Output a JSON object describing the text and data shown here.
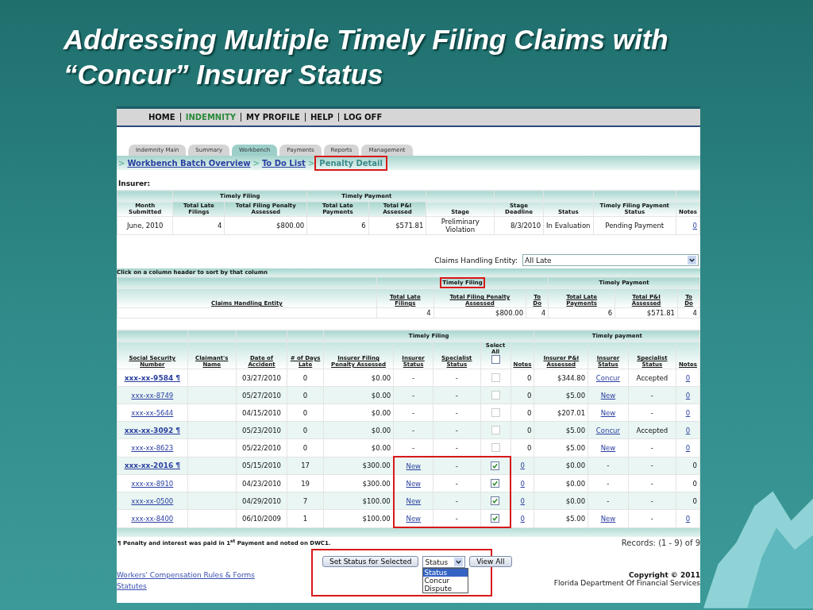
{
  "slide_title": "Addressing Multiple Timely Filing Claims with “Concur” Insurer Status",
  "nav": [
    {
      "label": "HOME",
      "selected": false
    },
    {
      "label": "INDEMNITY",
      "selected": true
    },
    {
      "label": "MY PROFILE",
      "selected": false
    },
    {
      "label": "HELP",
      "selected": false
    },
    {
      "label": "LOG OFF",
      "selected": false
    }
  ],
  "tabs": [
    {
      "label": "Indemnity Main",
      "selected": false
    },
    {
      "label": "Summary",
      "selected": false
    },
    {
      "label": "Workbench",
      "selected": true
    },
    {
      "label": "Payments",
      "selected": false
    },
    {
      "label": "Reports",
      "selected": false
    },
    {
      "label": "Management",
      "selected": false
    }
  ],
  "breadcrumb": {
    "separator": ">",
    "items": [
      {
        "label": "Workbench Batch Overview",
        "current": false,
        "highlighted": false
      },
      {
        "label": "To Do List",
        "current": false,
        "highlighted": false
      },
      {
        "label": "Penalty Detail",
        "current": true,
        "highlighted": true
      }
    ]
  },
  "insurer_label": "Insurer:",
  "summary": {
    "group_filing": "Timely Filing",
    "group_payment": "Timely Payment",
    "columns": [
      "Month Submitted",
      "Total Late Filings",
      "Total Filing Penalty Assessed",
      "Total Late Payments",
      "Total P&I Assessed",
      "Stage",
      "Stage Deadline",
      "Status",
      "Timely Filing Payment Status",
      "Notes"
    ],
    "row": [
      {
        "text": "June, 2010",
        "link": false
      },
      {
        "text": "4",
        "link": false
      },
      {
        "text": "$800.00",
        "link": false
      },
      {
        "text": "6",
        "link": false
      },
      {
        "text": "$571.81",
        "link": false
      },
      {
        "text": "Preliminary Violation",
        "link": false
      },
      {
        "text": "8/3/2010",
        "link": false
      },
      {
        "text": "In Evaluation",
        "link": false
      },
      {
        "text": "Pending Payment",
        "link": false
      },
      {
        "text": "0",
        "link": true
      }
    ]
  },
  "entity_filter": {
    "label": "Claims Handling Entity:",
    "value": "All Late"
  },
  "sort_hint": "Click on a column header to sort by that column",
  "entity_table": {
    "group_filing": "Timely Filing",
    "group_filing_highlighted": true,
    "group_payment": "Timely Payment",
    "columns": [
      "Claims Handling Entity",
      "Total Late Filings",
      "Total Filing Penalty Assessed",
      "To Do",
      "Total Late Payments",
      "Total P&I Assessed",
      "To Do"
    ],
    "row": [
      "4",
      "$800.00",
      "4",
      "6",
      "$571.81",
      "4"
    ]
  },
  "claims": {
    "group_filing": "Timely Filing",
    "group_payment": "Timely payment",
    "select_all": {
      "label": "Select All",
      "checked": false
    },
    "columns": [
      "Social Security Number",
      "Claimant's Name",
      "Date of Accident",
      "# of Days Late",
      "Insurer Filing Penalty Assessed",
      "Insurer Status",
      "Specialist Status",
      "Notes",
      "Insurer P&I Assessed",
      "Insurer Status",
      "Specialist Status",
      "Notes"
    ],
    "rows": [
      {
        "ssn": "xxx-xx-9584 ¶",
        "bold": true,
        "date": "03/27/2010",
        "days": "0",
        "penalty": "$0.00",
        "fil_status": "-",
        "fil_status_link": false,
        "fil_spec": "-",
        "checked": false,
        "disabled": true,
        "fil_notes": "0",
        "fil_notes_link": false,
        "pi": "$344.80",
        "pay_status": "Concur",
        "pay_status_link": true,
        "pay_spec": "Accepted",
        "pay_notes": "0",
        "pay_notes_link": true,
        "highlighted": false
      },
      {
        "ssn": "xxx-xx-8749",
        "bold": false,
        "date": "05/27/2010",
        "days": "0",
        "penalty": "$0.00",
        "fil_status": "-",
        "fil_status_link": false,
        "fil_spec": "-",
        "checked": false,
        "disabled": true,
        "fil_notes": "0",
        "fil_notes_link": false,
        "pi": "$5.00",
        "pay_status": "New",
        "pay_status_link": true,
        "pay_spec": "-",
        "pay_notes": "0",
        "pay_notes_link": true,
        "highlighted": false
      },
      {
        "ssn": "xxx-xx-5644",
        "bold": false,
        "date": "04/15/2010",
        "days": "0",
        "penalty": "$0.00",
        "fil_status": "-",
        "fil_status_link": false,
        "fil_spec": "-",
        "checked": false,
        "disabled": true,
        "fil_notes": "0",
        "fil_notes_link": false,
        "pi": "$207.01",
        "pay_status": "New",
        "pay_status_link": true,
        "pay_spec": "-",
        "pay_notes": "0",
        "pay_notes_link": true,
        "highlighted": false
      },
      {
        "ssn": "xxx-xx-3092 ¶",
        "bold": true,
        "date": "05/23/2010",
        "days": "0",
        "penalty": "$0.00",
        "fil_status": "-",
        "fil_status_link": false,
        "fil_spec": "-",
        "checked": false,
        "disabled": true,
        "fil_notes": "0",
        "fil_notes_link": false,
        "pi": "$5.00",
        "pay_status": "Concur",
        "pay_status_link": true,
        "pay_spec": "Accepted",
        "pay_notes": "0",
        "pay_notes_link": true,
        "highlighted": false
      },
      {
        "ssn": "xxx-xx-8623",
        "bold": false,
        "date": "05/22/2010",
        "days": "0",
        "penalty": "$0.00",
        "fil_status": "-",
        "fil_status_link": false,
        "fil_spec": "-",
        "checked": false,
        "disabled": true,
        "fil_notes": "0",
        "fil_notes_link": false,
        "pi": "$5.00",
        "pay_status": "New",
        "pay_status_link": true,
        "pay_spec": "-",
        "pay_notes": "0",
        "pay_notes_link": true,
        "highlighted": false
      },
      {
        "ssn": "xxx-xx-2016 ¶",
        "bold": true,
        "date": "05/15/2010",
        "days": "17",
        "penalty": "$300.00",
        "fil_status": "New",
        "fil_status_link": true,
        "fil_spec": "-",
        "checked": true,
        "disabled": false,
        "fil_notes": "0",
        "fil_notes_link": true,
        "pi": "$0.00",
        "pay_status": "-",
        "pay_status_link": false,
        "pay_spec": "-",
        "pay_notes": "0",
        "pay_notes_link": false,
        "highlighted": true
      },
      {
        "ssn": "xxx-xx-8910",
        "bold": false,
        "date": "04/23/2010",
        "days": "19",
        "penalty": "$300.00",
        "fil_status": "New",
        "fil_status_link": true,
        "fil_spec": "-",
        "checked": true,
        "disabled": false,
        "fil_notes": "0",
        "fil_notes_link": true,
        "pi": "$0.00",
        "pay_status": "-",
        "pay_status_link": false,
        "pay_spec": "-",
        "pay_notes": "0",
        "pay_notes_link": false,
        "highlighted": true
      },
      {
        "ssn": "xxx-xx-0500",
        "bold": false,
        "date": "04/29/2010",
        "days": "7",
        "penalty": "$100.00",
        "fil_status": "New",
        "fil_status_link": true,
        "fil_spec": "-",
        "checked": true,
        "disabled": false,
        "fil_notes": "0",
        "fil_notes_link": true,
        "pi": "$0.00",
        "pay_status": "-",
        "pay_status_link": false,
        "pay_spec": "-",
        "pay_notes": "0",
        "pay_notes_link": false,
        "highlighted": true
      },
      {
        "ssn": "xxx-xx-8400",
        "bold": false,
        "date": "06/10/2009",
        "days": "1",
        "penalty": "$100.00",
        "fil_status": "New",
        "fil_status_link": true,
        "fil_spec": "-",
        "checked": true,
        "disabled": false,
        "fil_notes": "0",
        "fil_notes_link": true,
        "pi": "$5.00",
        "pay_status": "New",
        "pay_status_link": true,
        "pay_spec": "-",
        "pay_notes": "0",
        "pay_notes_link": true,
        "highlighted": true
      }
    ]
  },
  "footnote": "¶ Penalty and interest was paid in 1$^{st}$ Payment and noted on DWC1.",
  "records": "Records: (1 - 9) of 9",
  "actions": {
    "highlighted": true,
    "set_button": "Set Status for Selected",
    "status_value": "Status",
    "options": [
      {
        "label": "Status",
        "selected": true
      },
      {
        "label": "Concur",
        "selected": false
      },
      {
        "label": "Dispute",
        "selected": false
      }
    ],
    "view_all": "View All"
  },
  "footer_links": [
    "Workers' Compensation Rules & Forms",
    "Statutes"
  ],
  "copyright": [
    "Copyright © 2011",
    "Florida Department Of Financial Services"
  ]
}
